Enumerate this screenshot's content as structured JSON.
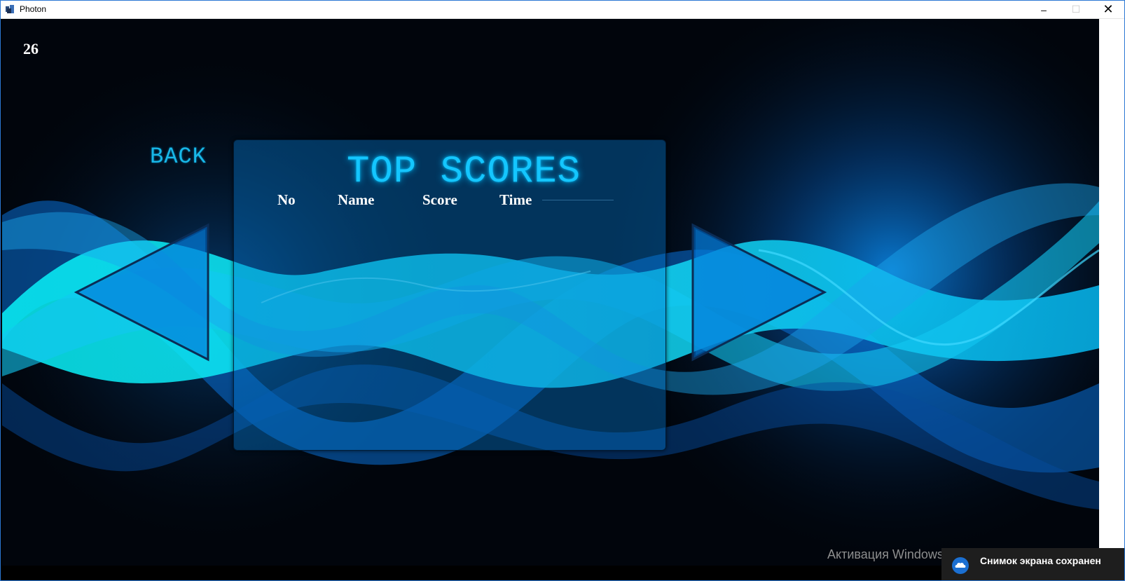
{
  "window": {
    "title": "Photon",
    "controls": {
      "minimize": "–",
      "maximize": "☐",
      "close": "✕"
    }
  },
  "hud": {
    "counter": "26"
  },
  "nav": {
    "back_label": "BACK"
  },
  "scores_panel": {
    "title": "TOP SCORES",
    "columns": [
      "No",
      "Name",
      "Score",
      "Time"
    ]
  },
  "arrows": {
    "left_icon": "triangle-left-icon",
    "right_icon": "triangle-right-icon"
  },
  "os_overlay": {
    "activation_text": "Активация Windows",
    "toast_text": "Снимок экрана сохранен"
  },
  "colors": {
    "accent": "#14c6ff",
    "background": "#01050c",
    "wave_cyan": "#0ee8f5",
    "wave_blue": "#0a7fe0"
  }
}
